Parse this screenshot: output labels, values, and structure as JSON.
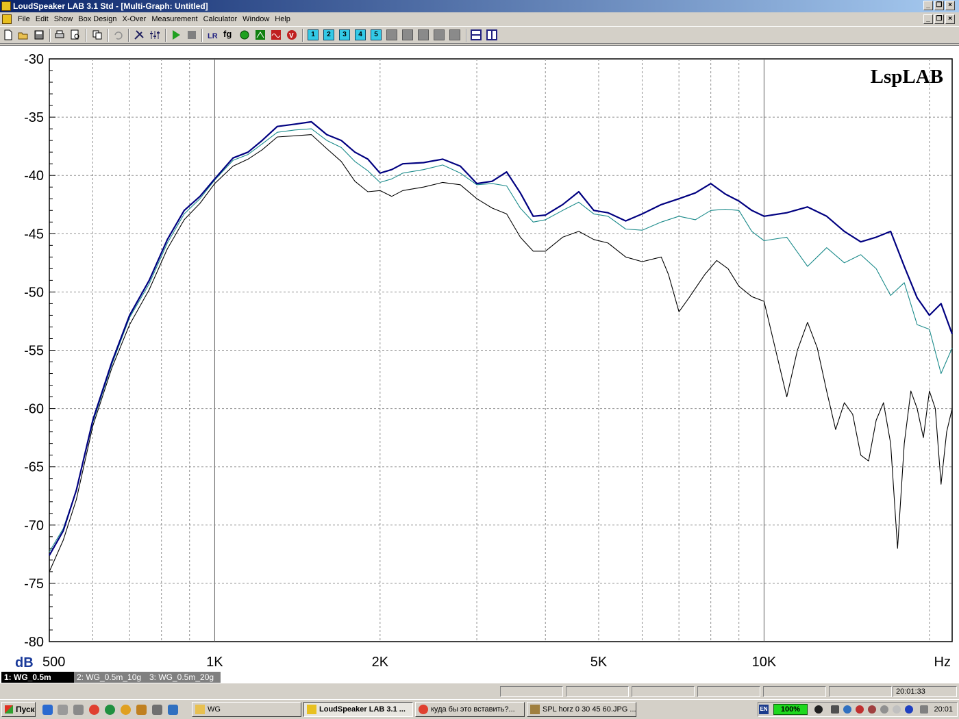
{
  "window": {
    "title": "LoudSpeaker LAB 3.1 Std - [Multi-Graph: Untitled]"
  },
  "menu": [
    "File",
    "Edit",
    "Show",
    "Box Design",
    "X-Over",
    "Measurement",
    "Calculator",
    "Window",
    "Help"
  ],
  "toolbar": {
    "buttons": [
      "new-icon",
      "open-icon",
      "save-icon",
      "print-icon",
      "print-preview-icon",
      "copy-icon",
      "undo-icon",
      "tools-icon",
      "eq-icon",
      "play-icon",
      "stop-icon",
      "lr-icon",
      "fg-icon",
      "green-circle-icon",
      "green-box-icon",
      "red-box-icon",
      "v-badge-icon"
    ],
    "numbered": [
      "1",
      "2",
      "3",
      "4",
      "5"
    ],
    "fg_label": "fg"
  },
  "graph": {
    "brand": "LspLAB",
    "y_unit": "dB",
    "x_unit": "Hz"
  },
  "chart_data": {
    "type": "line",
    "xscale": "log",
    "xlim": [
      500,
      22000
    ],
    "ylim": [
      -80,
      -30
    ],
    "grid": true,
    "x_tick_labels": [
      {
        "value": 500,
        "label": "500"
      },
      {
        "value": 1000,
        "label": "1K"
      },
      {
        "value": 2000,
        "label": "2K"
      },
      {
        "value": 5000,
        "label": "5K"
      },
      {
        "value": 10000,
        "label": "10K"
      }
    ],
    "y_ticks": [
      -30,
      -35,
      -40,
      -45,
      -50,
      -55,
      -60,
      -65,
      -70,
      -75,
      -80
    ],
    "series": [
      {
        "name": "1: WG_0.5m",
        "color": "#000080",
        "points": [
          [
            500,
            -72.6
          ],
          [
            530,
            -70.5
          ],
          [
            560,
            -67
          ],
          [
            600,
            -61
          ],
          [
            650,
            -56
          ],
          [
            700,
            -52
          ],
          [
            760,
            -49
          ],
          [
            820,
            -45.5
          ],
          [
            880,
            -43
          ],
          [
            940,
            -41.8
          ],
          [
            1000,
            -40.3
          ],
          [
            1080,
            -38.5
          ],
          [
            1150,
            -38
          ],
          [
            1220,
            -37
          ],
          [
            1300,
            -35.8
          ],
          [
            1400,
            -35.6
          ],
          [
            1500,
            -35.4
          ],
          [
            1600,
            -36.5
          ],
          [
            1700,
            -37
          ],
          [
            1800,
            -38
          ],
          [
            1900,
            -38.6
          ],
          [
            2000,
            -39.8
          ],
          [
            2100,
            -39.5
          ],
          [
            2200,
            -39
          ],
          [
            2400,
            -38.9
          ],
          [
            2600,
            -38.6
          ],
          [
            2800,
            -39.2
          ],
          [
            3000,
            -40.7
          ],
          [
            3200,
            -40.5
          ],
          [
            3400,
            -39.7
          ],
          [
            3600,
            -41.5
          ],
          [
            3800,
            -43.5
          ],
          [
            4000,
            -43.4
          ],
          [
            4300,
            -42.5
          ],
          [
            4600,
            -41.4
          ],
          [
            4900,
            -43
          ],
          [
            5200,
            -43.2
          ],
          [
            5600,
            -43.9
          ],
          [
            6000,
            -43.3
          ],
          [
            6500,
            -42.5
          ],
          [
            7000,
            -42
          ],
          [
            7500,
            -41.5
          ],
          [
            8000,
            -40.7
          ],
          [
            8500,
            -41.6
          ],
          [
            9000,
            -42.2
          ],
          [
            9500,
            -43
          ],
          [
            10000,
            -43.5
          ],
          [
            11000,
            -43.2
          ],
          [
            12000,
            -42.7
          ],
          [
            13000,
            -43.5
          ],
          [
            14000,
            -44.8
          ],
          [
            15000,
            -45.7
          ],
          [
            16000,
            -45.3
          ],
          [
            17000,
            -44.8
          ],
          [
            18000,
            -47.8
          ],
          [
            19000,
            -50.5
          ],
          [
            20000,
            -52
          ],
          [
            21000,
            -51
          ],
          [
            22000,
            -53.6
          ]
        ]
      },
      {
        "name": "2: WG_0.5m_10g",
        "color": "#1a8a8a",
        "points": [
          [
            500,
            -72.3
          ],
          [
            530,
            -70.3
          ],
          [
            560,
            -67
          ],
          [
            600,
            -61.2
          ],
          [
            650,
            -56.2
          ],
          [
            700,
            -52.2
          ],
          [
            760,
            -49.3
          ],
          [
            820,
            -45.8
          ],
          [
            880,
            -43.3
          ],
          [
            940,
            -42
          ],
          [
            1000,
            -40.4
          ],
          [
            1080,
            -38.7
          ],
          [
            1150,
            -38.2
          ],
          [
            1220,
            -37.3
          ],
          [
            1300,
            -36.3
          ],
          [
            1400,
            -36.1
          ],
          [
            1500,
            -36
          ],
          [
            1600,
            -37
          ],
          [
            1700,
            -37.6
          ],
          [
            1800,
            -38.8
          ],
          [
            1900,
            -39.6
          ],
          [
            2000,
            -40.6
          ],
          [
            2100,
            -40.3
          ],
          [
            2200,
            -39.8
          ],
          [
            2400,
            -39.5
          ],
          [
            2600,
            -39.1
          ],
          [
            2800,
            -39.8
          ],
          [
            3000,
            -40.8
          ],
          [
            3200,
            -40.7
          ],
          [
            3400,
            -40.9
          ],
          [
            3600,
            -42.8
          ],
          [
            3800,
            -44
          ],
          [
            4000,
            -43.8
          ],
          [
            4300,
            -43
          ],
          [
            4600,
            -42.3
          ],
          [
            4900,
            -43.3
          ],
          [
            5200,
            -43.5
          ],
          [
            5600,
            -44.6
          ],
          [
            6000,
            -44.7
          ],
          [
            6500,
            -44
          ],
          [
            7000,
            -43.5
          ],
          [
            7500,
            -43.8
          ],
          [
            8000,
            -43
          ],
          [
            8500,
            -42.9
          ],
          [
            9000,
            -43
          ],
          [
            9500,
            -44.8
          ],
          [
            10000,
            -45.6
          ],
          [
            11000,
            -45.3
          ],
          [
            12000,
            -47.8
          ],
          [
            13000,
            -46.2
          ],
          [
            14000,
            -47.5
          ],
          [
            15000,
            -46.8
          ],
          [
            16000,
            -48
          ],
          [
            17000,
            -50.3
          ],
          [
            18000,
            -49.2
          ],
          [
            19000,
            -52.8
          ],
          [
            20000,
            -53.2
          ],
          [
            21000,
            -57
          ],
          [
            22000,
            -54.8
          ]
        ]
      },
      {
        "name": "3: WG_0.5m_20g",
        "color": "#000000",
        "points": [
          [
            500,
            -74
          ],
          [
            530,
            -71.3
          ],
          [
            560,
            -67.8
          ],
          [
            600,
            -61.5
          ],
          [
            650,
            -56.5
          ],
          [
            700,
            -52.8
          ],
          [
            760,
            -49.8
          ],
          [
            820,
            -46.3
          ],
          [
            880,
            -43.8
          ],
          [
            940,
            -42.4
          ],
          [
            1000,
            -40.7
          ],
          [
            1080,
            -39.2
          ],
          [
            1150,
            -38.6
          ],
          [
            1220,
            -37.8
          ],
          [
            1300,
            -36.7
          ],
          [
            1400,
            -36.6
          ],
          [
            1500,
            -36.5
          ],
          [
            1600,
            -37.7
          ],
          [
            1700,
            -38.8
          ],
          [
            1800,
            -40.5
          ],
          [
            1900,
            -41.4
          ],
          [
            2000,
            -41.3
          ],
          [
            2100,
            -41.8
          ],
          [
            2200,
            -41.3
          ],
          [
            2400,
            -41
          ],
          [
            2600,
            -40.6
          ],
          [
            2800,
            -40.8
          ],
          [
            3000,
            -42
          ],
          [
            3200,
            -42.8
          ],
          [
            3400,
            -43.3
          ],
          [
            3600,
            -45.3
          ],
          [
            3800,
            -46.5
          ],
          [
            4000,
            -46.5
          ],
          [
            4300,
            -45.3
          ],
          [
            4600,
            -44.8
          ],
          [
            4900,
            -45.5
          ],
          [
            5200,
            -45.8
          ],
          [
            5600,
            -47
          ],
          [
            6000,
            -47.4
          ],
          [
            6500,
            -47
          ],
          [
            6700,
            -48.5
          ],
          [
            7000,
            -51.7
          ],
          [
            7300,
            -50.5
          ],
          [
            7800,
            -48.5
          ],
          [
            8200,
            -47.3
          ],
          [
            8600,
            -48
          ],
          [
            9000,
            -49.5
          ],
          [
            9500,
            -50.4
          ],
          [
            10000,
            -50.8
          ],
          [
            10500,
            -55
          ],
          [
            11000,
            -59
          ],
          [
            11500,
            -55
          ],
          [
            12000,
            -52.6
          ],
          [
            12500,
            -54.8
          ],
          [
            13000,
            -58.5
          ],
          [
            13500,
            -61.8
          ],
          [
            14000,
            -59.5
          ],
          [
            14500,
            -60.5
          ],
          [
            15000,
            -64
          ],
          [
            15500,
            -64.5
          ],
          [
            16000,
            -61
          ],
          [
            16500,
            -59.5
          ],
          [
            17000,
            -63
          ],
          [
            17500,
            -72
          ],
          [
            18000,
            -63
          ],
          [
            18500,
            -58.5
          ],
          [
            19000,
            -60
          ],
          [
            19500,
            -62.5
          ],
          [
            20000,
            -58.5
          ],
          [
            20500,
            -60
          ],
          [
            21000,
            -66.5
          ],
          [
            21500,
            -62
          ],
          [
            22000,
            -60
          ]
        ]
      }
    ]
  },
  "curve_tabs": [
    {
      "label": "1: WG_0.5m",
      "active": true
    },
    {
      "label": "2: WG_0.5m_10g",
      "active": false
    },
    {
      "label": "3: WG_0.5m_20g",
      "active": false
    }
  ],
  "status": {
    "time": "20:01:33"
  },
  "taskbar": {
    "start_label": "Пуск",
    "tasks": [
      {
        "label": "WG",
        "icon": "folder-icon",
        "active": false
      },
      {
        "label": "LoudSpeaker LAB 3.1 ...",
        "icon": "app-icon",
        "active": true
      },
      {
        "label": "куда бы это вставить?...",
        "icon": "browser-icon",
        "active": false
      },
      {
        "label": "SPL horz 0 30 45 60.JPG ...",
        "icon": "image-viewer-icon",
        "active": false
      }
    ],
    "lang": "EN",
    "battery": "100%",
    "clock": "20:01"
  }
}
